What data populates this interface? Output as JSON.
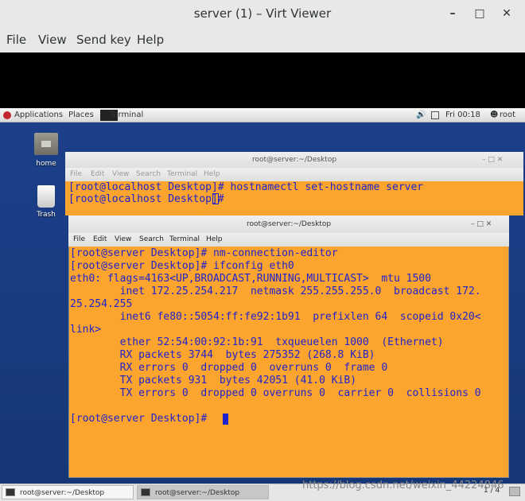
{
  "window": {
    "title": "server (1) – Virt Viewer",
    "minimize": "–",
    "maximize": "□",
    "close": "✕"
  },
  "menubar": [
    "File",
    "View",
    "Send key",
    "Help"
  ],
  "guest_panel": {
    "applications": "Applications",
    "places": "Places",
    "terminal": "Terminal",
    "clock": "Fri 00:18",
    "user": "root",
    "icons": [
      "volume-icon",
      "network-icon",
      "battery-icon",
      "user-icon"
    ]
  },
  "desktop_icons": [
    {
      "label": "home",
      "icon": "home-folder-icon"
    },
    {
      "label": "Trash",
      "icon": "trash-icon"
    }
  ],
  "terminal_back": {
    "title": "root@server:~/Desktop",
    "menu": [
      "File",
      "Edit",
      "View",
      "Search",
      "Terminal",
      "Help"
    ],
    "lines": [
      "[root@localhost Desktop]# hostnamectl set-hostname server",
      "[root@localhost Desktop]# "
    ]
  },
  "terminal_front": {
    "title": "root@server:~/Desktop",
    "menu": [
      "File",
      "Edit",
      "View",
      "Search",
      "Terminal",
      "Help"
    ],
    "lines": [
      "[root@server Desktop]# nm-connection-editor",
      "[root@server Desktop]# ifconfig eth0",
      "eth0: flags=4163<UP,BROADCAST,RUNNING,MULTICAST>  mtu 1500",
      "        inet 172.25.254.217  netmask 255.255.255.0  broadcast 172.",
      "25.254.255",
      "        inet6 fe80::5054:ff:fe92:1b91  prefixlen 64  scopeid 0x20<",
      "link>",
      "        ether 52:54:00:92:1b:91  txqueuelen 1000  (Ethernet)",
      "        RX packets 3744  bytes 275352 (268.8 KiB)",
      "        RX errors 0  dropped 0  overruns 0  frame 0",
      "        TX packets 931  bytes 42051 (41.0 KiB)",
      "        TX errors 0  dropped 0 overruns 0  carrier 0  collisions 0",
      "",
      "[root@server Desktop]# "
    ]
  },
  "taskbar": {
    "tasks": [
      "root@server:~/Desktop",
      "root@server:~/Desktop"
    ],
    "watermark": "https://blog.csdn.net/weixin_44224846",
    "workspace": "1 / 4"
  },
  "colors": {
    "terminal_bg": "#fba42e",
    "terminal_text": "#2222cc",
    "desktop_bg": "#1a3c85"
  }
}
